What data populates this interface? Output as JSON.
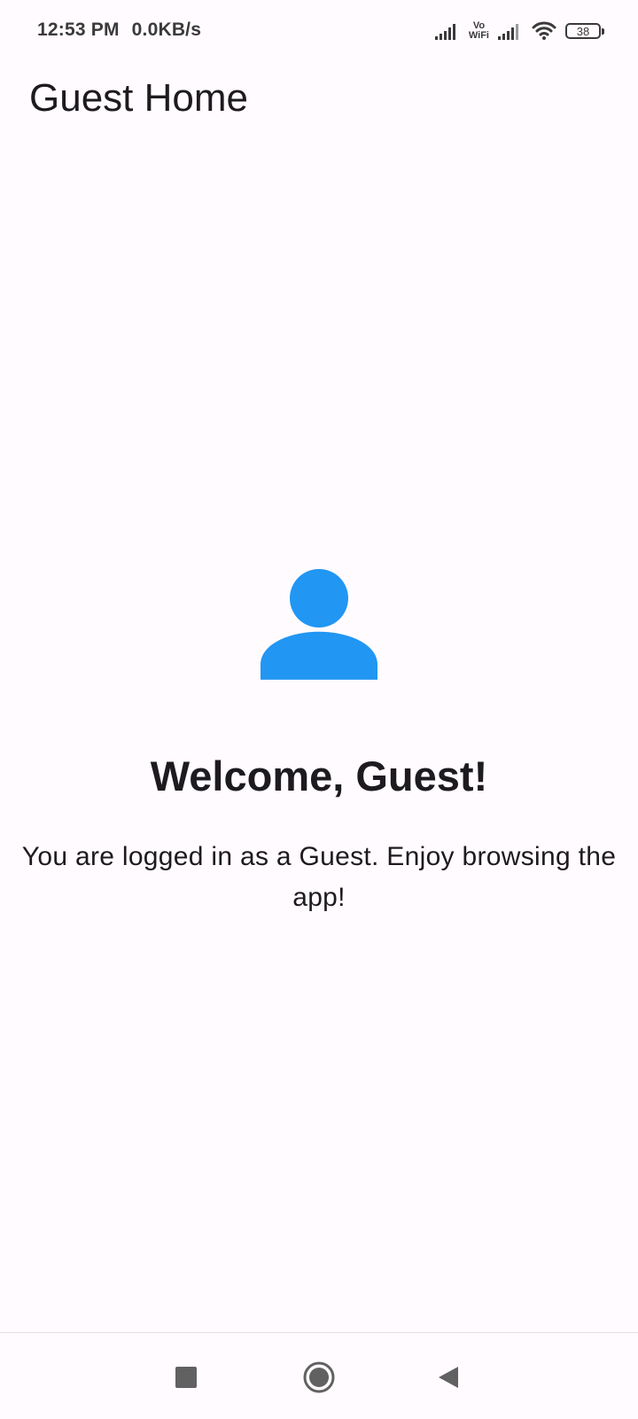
{
  "status_bar": {
    "time": "12:53 PM",
    "speed": "0.0KB/s",
    "vowifi_top": "Vo",
    "vowifi_bottom": "WiFi",
    "battery": "38",
    "icons": [
      "signal-icon",
      "vowifi-icon",
      "signal-icon",
      "wifi-icon",
      "battery-icon"
    ]
  },
  "app_bar": {
    "title": "Guest Home"
  },
  "main": {
    "icon": "person-icon",
    "icon_color": "#2196f3",
    "title": "Welcome, Guest!",
    "message": "You are logged in as a Guest. Enjoy browsing the app!"
  },
  "nav_bar": {
    "buttons": [
      "recents-icon",
      "home-icon",
      "back-icon"
    ]
  },
  "colors": {
    "background": "#fffbfe",
    "text": "#1d1b20",
    "accent": "#2196f3"
  }
}
